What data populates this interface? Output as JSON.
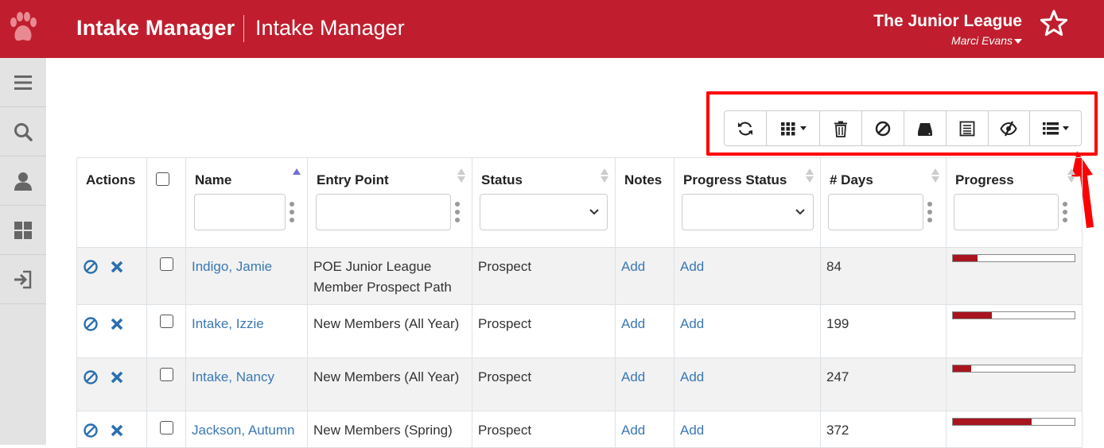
{
  "header": {
    "app_title": "Intake Manager",
    "app_subtitle": "Intake Manager",
    "org_name": "The Junior League",
    "user_name": "Marci Evans",
    "brand_color": "#c01e2e"
  },
  "sidebar": {
    "items": [
      {
        "icon": "menu-icon"
      },
      {
        "icon": "search-icon"
      },
      {
        "icon": "user-icon"
      },
      {
        "icon": "dashboard-icon"
      },
      {
        "icon": "sign-in-icon"
      }
    ]
  },
  "toolbar": {
    "buttons": [
      {
        "icon": "refresh-icon"
      },
      {
        "icon": "columns-grid-icon",
        "dropdown": true
      },
      {
        "icon": "trash-icon"
      },
      {
        "icon": "ban-icon"
      },
      {
        "icon": "drive-icon"
      },
      {
        "icon": "list-alt-icon"
      },
      {
        "icon": "eye-slash-icon"
      },
      {
        "icon": "list-icon",
        "dropdown": true
      }
    ]
  },
  "table": {
    "columns": [
      "Actions",
      "",
      "Name",
      "Entry Point",
      "Status",
      "Notes",
      "Progress Status",
      "# Days",
      "Progress"
    ],
    "rows": [
      {
        "name": "Indigo, Jamie",
        "entry_point": "POE Junior League Member Prospect Path",
        "status": "Prospect",
        "notes": "Add",
        "progress_status": "Add",
        "days": "84",
        "progress": 0.2
      },
      {
        "name": "Intake, Izzie",
        "entry_point": "New Members (All Year)",
        "status": "Prospect",
        "notes": "Add",
        "progress_status": "Add",
        "days": "199",
        "progress": 0.32
      },
      {
        "name": "Intake, Nancy",
        "entry_point": "New Members (All Year)",
        "status": "Prospect",
        "notes": "Add",
        "progress_status": "Add",
        "days": "247",
        "progress": 0.15
      },
      {
        "name": "Jackson, Autumn",
        "entry_point": "New Members (Spring)",
        "status": "Prospect",
        "notes": "Add",
        "progress_status": "Add",
        "days": "372",
        "progress": 0.65
      }
    ]
  },
  "annotation": {
    "color": "#ff0000"
  }
}
